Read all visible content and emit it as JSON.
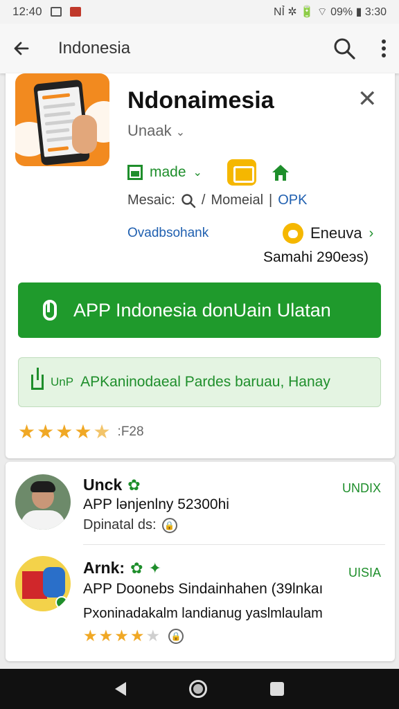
{
  "status_bar": {
    "time": "12:40",
    "right_text": "NỈ ✲ 🔋 ⌔ 09% ▮ 3:30"
  },
  "app_bar": {
    "title": "Indonesia"
  },
  "app": {
    "name": "Ndonaimesia",
    "developer": "Unaak",
    "made_label": "made",
    "meta_prefix": "Mesaic:",
    "meta_mid": "Momeial",
    "meta_suffix": "OPK",
    "ovad_text": "Ovadbsohank",
    "eneuva_label": "Eneuva",
    "samahi_text": "Samahi 290eэs)",
    "install_button": "APP Indonesia donUain Ulatan",
    "apk_label": "UnP",
    "apk_text": "APKaninodaeal Pardes baruau, Hanay",
    "rating_count": ":F28",
    "rating_value": 4.5
  },
  "reviews": [
    {
      "name": "Unck",
      "text": "APP lənjenlny 52300hi",
      "sub": "Dpinatal ds:",
      "tag": "UNDIX",
      "stars": 0
    },
    {
      "name": "Arnk:",
      "text": "APP Doonebs Sindainhahen (39lnkaı",
      "sub": "Pxoninadakalm landianug yaslmlaulam",
      "tag": "UISIA",
      "stars": 4
    }
  ],
  "colors": {
    "green": "#1f9a2c",
    "apk_bg": "#e4f4e2",
    "star": "#f0a825",
    "icon_orange": "#f28a1f"
  }
}
